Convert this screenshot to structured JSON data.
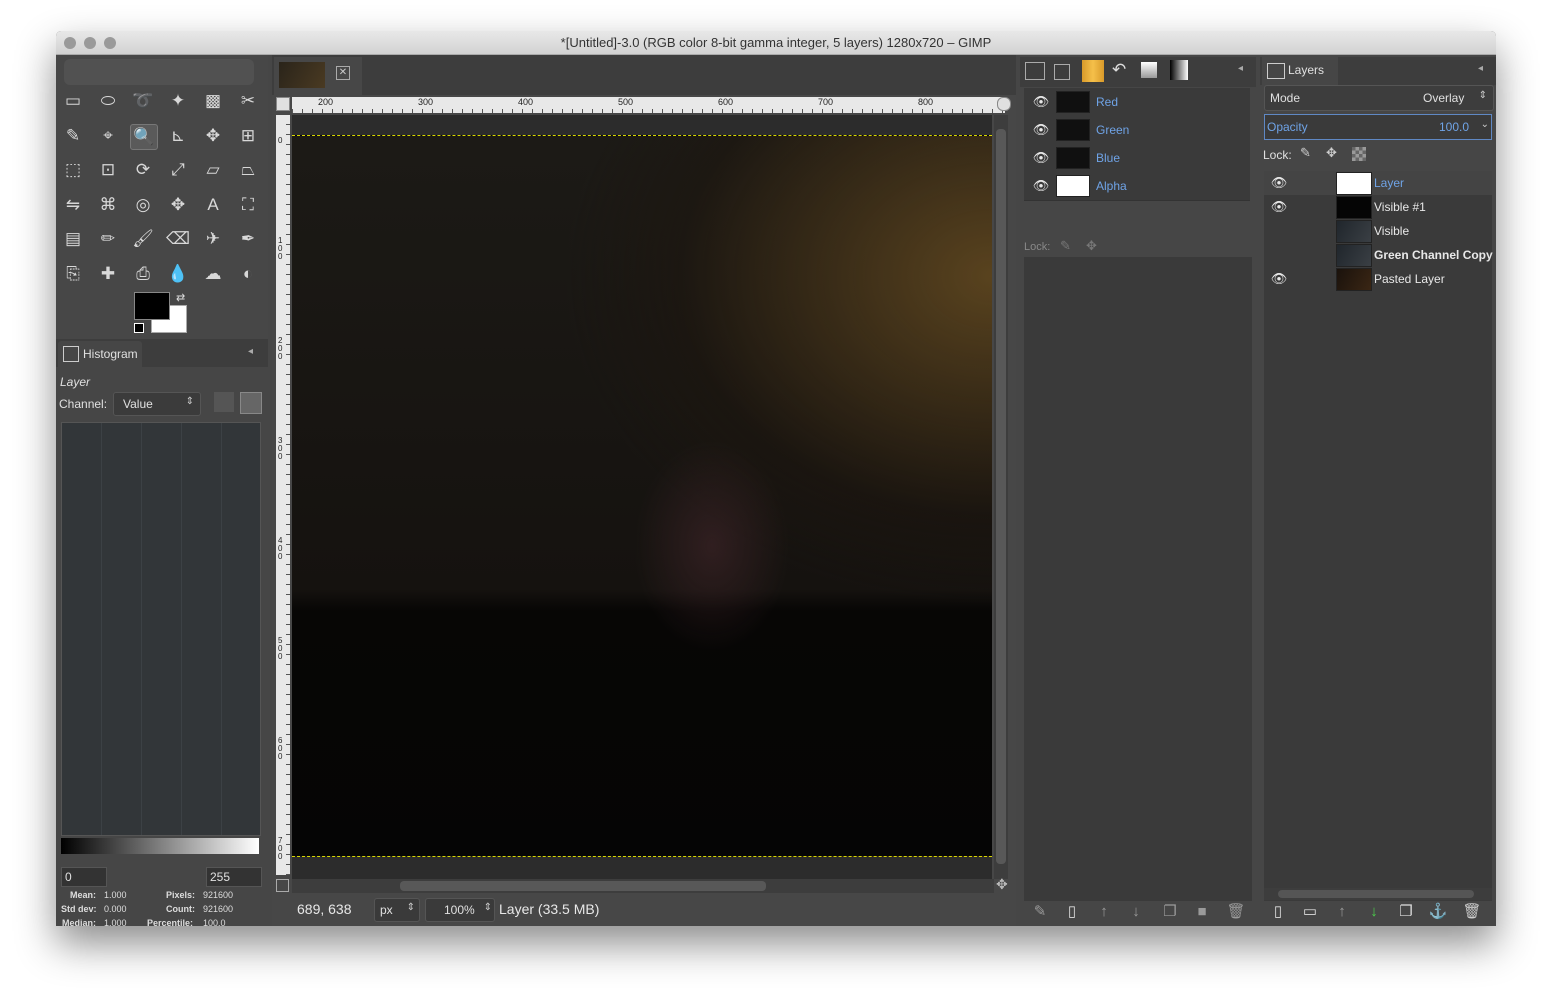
{
  "window": {
    "title": "*[Untitled]-3.0 (RGB color 8-bit gamma integer, 5 layers) 1280x720 – GIMP"
  },
  "toolbox": {
    "tool_icons": [
      "rect-select-icon",
      "ellipse-select-icon",
      "lasso-icon",
      "fuzzy-select-icon",
      "select-by-color-icon",
      "scissors-select-icon",
      "paths-icon",
      "color-picker-icon",
      "zoom-icon",
      "measure-icon",
      "move-icon",
      "align-icon",
      "crop-icon",
      "unified-transform-icon",
      "rotate-icon",
      "scale-icon",
      "shear-icon",
      "perspective-icon",
      "flip-icon",
      "cage-icon",
      "warp-icon",
      "move-cross-icon",
      "text-icon",
      "bucket-fill-icon",
      "blend-icon",
      "pencil-icon",
      "paintbrush-icon",
      "eraser-icon",
      "airbrush-icon",
      "ink-icon",
      "clone-icon",
      "heal-icon",
      "perspective-clone-icon",
      "blur-icon",
      "smudge-icon",
      "dodge-icon"
    ],
    "fg_color": "#000000",
    "bg_color": "#ffffff"
  },
  "histogram": {
    "tab_label": "Histogram",
    "layer_label": "Layer",
    "channel_label": "Channel:",
    "channel_value": "Value",
    "range_min": "0",
    "range_max": "255",
    "stats": {
      "mean_label": "Mean:",
      "mean": "1.000",
      "stddev_label": "Std dev:",
      "stddev": "0.000",
      "median_label": "Median:",
      "median": "1.000",
      "pixels_label": "Pixels:",
      "pixels": "921600",
      "count_label": "Count:",
      "count": "921600",
      "percentile_label": "Percentile:",
      "percentile": "100.0"
    }
  },
  "canvas": {
    "ruler_labels": [
      "200",
      "300",
      "400",
      "500",
      "600",
      "700",
      "800"
    ],
    "vruler_labels": [
      "0",
      "100",
      "200",
      "300",
      "400",
      "500",
      "600",
      "700"
    ],
    "coords": "689, 638",
    "unit": "px",
    "zoom": "100%",
    "status": "Layer (33.5 MB)"
  },
  "channels": {
    "items": [
      {
        "name": "Red"
      },
      {
        "name": "Green"
      },
      {
        "name": "Blue"
      },
      {
        "name": "Alpha"
      }
    ],
    "lock_label": "Lock:"
  },
  "layers": {
    "tab_label": "Layers",
    "mode_label": "Mode",
    "mode_value": "Overlay",
    "opacity_label": "Opacity",
    "opacity_value": "100.0",
    "lock_label": "Lock:",
    "items": [
      {
        "name": "Layer",
        "visible": true,
        "selected": true
      },
      {
        "name": "Visible #1",
        "visible": true,
        "selected": false
      },
      {
        "name": "Visible",
        "visible": false,
        "selected": false
      },
      {
        "name": "Green Channel Copy",
        "visible": false,
        "selected": false
      },
      {
        "name": "Pasted Layer",
        "visible": true,
        "selected": false
      }
    ]
  }
}
